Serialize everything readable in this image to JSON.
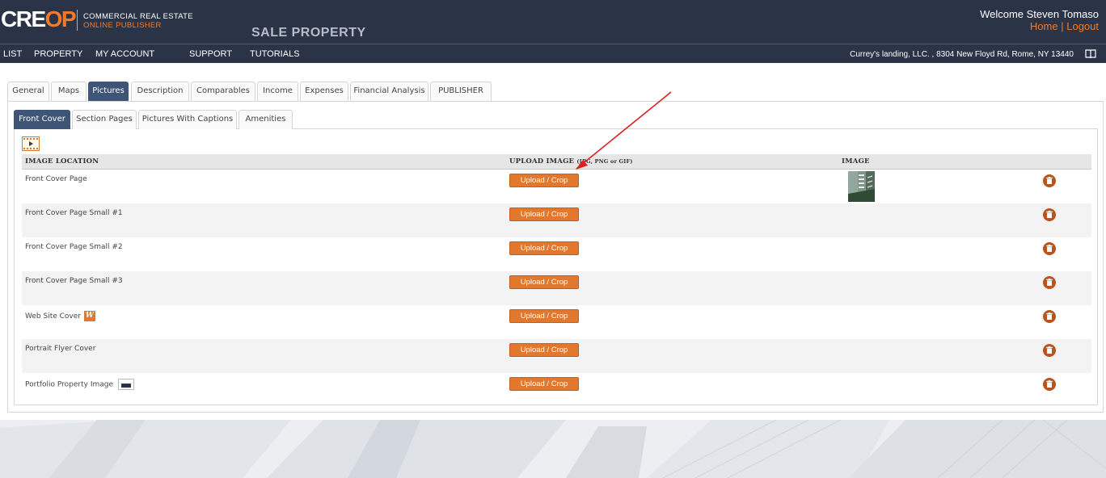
{
  "header": {
    "logo_white": "CRE",
    "logo_orange": "OP",
    "logo_line1": "COMMERCIAL REAL ESTATE",
    "logo_line2": "ONLINE PUBLISHER",
    "page_heading": "SALE PROPERTY",
    "welcome": "Welcome Steven Tomaso",
    "home_link": "Home",
    "separator": "|",
    "logout_link": "Logout"
  },
  "nav": {
    "items": [
      {
        "label": "LIST"
      },
      {
        "label": "PROPERTY"
      },
      {
        "label": "MY ACCOUNT"
      },
      {
        "label": "SUPPORT"
      },
      {
        "label": "TUTORIALS"
      }
    ],
    "address": "Currey's landing, LLC. , 8304 New Floyd Rd, Rome, NY 13440",
    "address_icon": "book-icon"
  },
  "tabs": [
    {
      "label": "General"
    },
    {
      "label": "Maps"
    },
    {
      "label": "Pictures",
      "active": true
    },
    {
      "label": "Description"
    },
    {
      "label": "Comparables"
    },
    {
      "label": "Income"
    },
    {
      "label": "Expenses"
    },
    {
      "label": "Financial Analysis"
    },
    {
      "label": "PUBLISHER"
    }
  ],
  "subtabs": [
    {
      "label": "Front Cover",
      "active": true
    },
    {
      "label": "Section Pages"
    },
    {
      "label": "Pictures With Captions"
    },
    {
      "label": "Amenities"
    }
  ],
  "toolbar": {
    "video_icon": "film-play-icon"
  },
  "table": {
    "headers": {
      "location": "IMAGE LOCATION",
      "upload": "UPLOAD IMAGE",
      "upload_formats": "(JPG, PNG or GIF)",
      "image": "IMAGE"
    },
    "upload_label": "Upload / Crop",
    "rows": [
      {
        "location": "Front Cover Page",
        "has_image": true
      },
      {
        "location": "Front Cover Page Small #1"
      },
      {
        "location": "Front Cover Page Small #2"
      },
      {
        "location": "Front Cover Page Small #3"
      },
      {
        "location": "Web Site Cover",
        "badge": "W"
      },
      {
        "location": "Portrait Flyer Cover"
      },
      {
        "location": "Portfolio Property Image",
        "icon": "monitor-icon"
      }
    ]
  },
  "colors": {
    "header_bg": "#2b3446",
    "accent": "#f07a2a",
    "button": "#e2782d",
    "active_tab": "#3f5575",
    "trash": "#b8541e",
    "annotation_arrow": "#e02020"
  }
}
